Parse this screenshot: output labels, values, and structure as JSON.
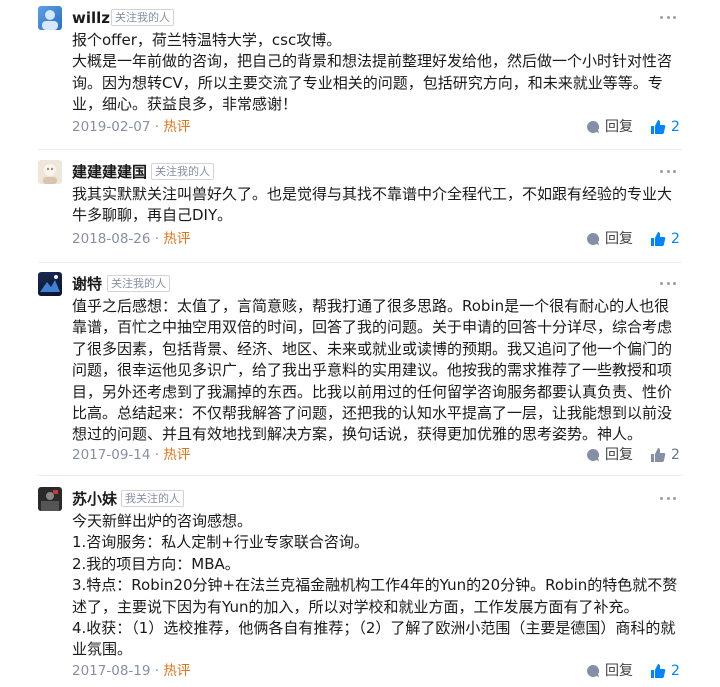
{
  "colors": {
    "hot": "#e0751b",
    "like_active": "#0084ff",
    "like_inactive": "#6b7785",
    "meta": "#8590a6"
  },
  "comments": [
    {
      "name": "willz",
      "badge": "关注我的人",
      "avatar_icon": "blue-avatar",
      "lines": [
        "报个offer，荷兰特温特大学，csc攻博。",
        "大概是一年前做的咨询，把自己的背景和想法提前整理好发给他，然后做一个小时针对性咨询。因为想转CV，所以主要交流了专业相关的问题，包括研究方向，和未来就业等等。专业，细心。获益良多，非常感谢！"
      ],
      "date": "2019-02-07",
      "sep": " · ",
      "hot": "热评",
      "reply": "回复",
      "likes": "2",
      "liked": true
    },
    {
      "name": "建建建建国",
      "badge": "关注我的人",
      "avatar_icon": "beige-avatar",
      "lines": [
        "我其实默默关注叫兽好久了。也是觉得与其找不靠谱中介全程代工，不如跟有经验的专业大牛多聊聊，再自己DIY。"
      ],
      "date": "2018-08-26",
      "sep": " · ",
      "hot": "热评",
      "reply": "回复",
      "likes": "2",
      "liked": true
    },
    {
      "name": "谢特",
      "badge": "关注我的人",
      "avatar_icon": "night-avatar",
      "lines": [
        "值乎之后感想：太值了，言简意赅，帮我打通了很多思路。Robin是一个很有耐心的人也很靠谱，百忙之中抽空用双倍的时间，回答了我的问题。关于申请的回答十分详尽，综合考虑了很多因素，包括背景、经济、地区、未来或就业或读博的预期。我又追问了他一个偏门的问题，很幸运他见多识广，给了我出乎意料的实用建议。他按我的需求推荐了一些教授和项目，另外还考虑到了我漏掉的东西。比我以前用过的任何留学咨询服务都要认真负责、性价比高。总结起来：不仅帮我解答了问题，还把我的认知水平提高了一层，让我能想到以前没想过的问题、并且有效地找到解决方案，换句话说，获得更加优雅的思考姿势。神人。"
      ],
      "date": "2017-09-14",
      "sep": " · ",
      "hot": "热评",
      "reply": "回复",
      "likes": "2",
      "liked": false
    },
    {
      "name": "苏小妹",
      "badge": "我关注的人",
      "avatar_icon": "dark-avatar",
      "lines": [
        "今天新鲜出炉的咨询感想。",
        "1.咨询服务：私人定制+行业专家联合咨询。",
        "2.我的项目方向：MBA。",
        "3.特点：Robin20分钟+在法兰克福金融机构工作4年的Yun的20分钟。Robin的特色就不赘述了，主要说下因为有Yun的加入，所以对学校和就业方面，工作发展方面有了补充。",
        "4.收获：（1）选校推荐，他俩各自有推荐；（2）了解了欧洲小范围（主要是德国）商科的就业氛围。"
      ],
      "date": "2017-08-19",
      "sep": " · ",
      "hot": "热评",
      "reply": "回复",
      "likes": "2",
      "liked": true
    }
  ]
}
